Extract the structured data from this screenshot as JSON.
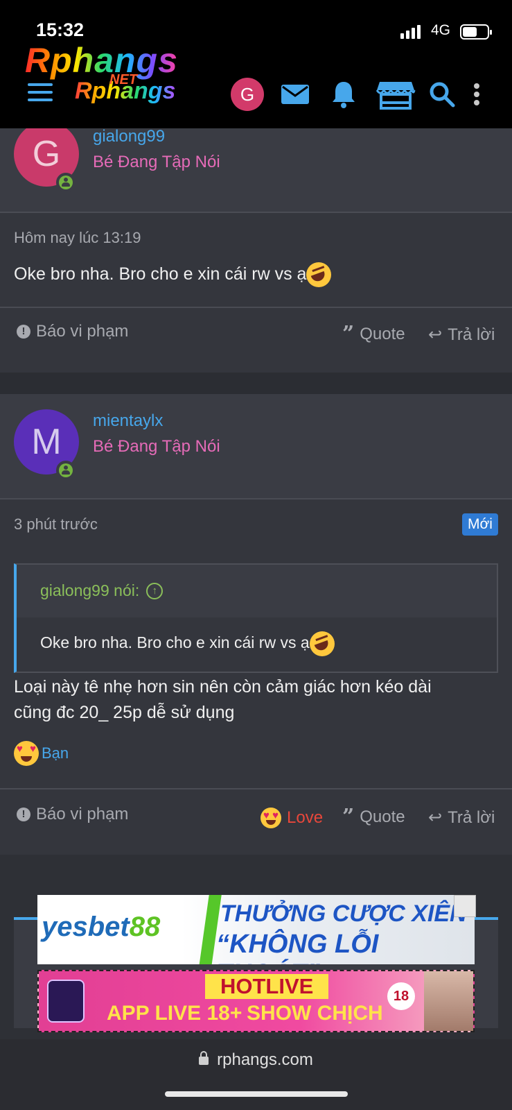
{
  "status_bar": {
    "time": "15:32",
    "network": "4G"
  },
  "header": {
    "logo_text": "Rphangs",
    "logo_small_text": "Rphangs",
    "logo_net_text": "NET",
    "user_initial": "G"
  },
  "posts": [
    {
      "username": "gialong99",
      "user_title": "Bé Đang Tập Nói",
      "avatar_letter": "G",
      "avatar_color": "#c93a6a",
      "time": "Hôm nay lúc 13:19",
      "body": "Oke bro nha. Bro cho e xin cái rw vs ạ",
      "report_label": "Báo vi phạm",
      "quote_label": "Quote",
      "reply_label": "Trả lời"
    },
    {
      "username": "mientaylx",
      "user_title": "Bé Đang Tập Nói",
      "avatar_letter": "M",
      "avatar_color": "#5a2fb8",
      "time": "3 phút trước",
      "new_badge": "Mới",
      "quote": {
        "author_line": "gialong99 nói:",
        "text": "Oke bro nha. Bro cho e xin cái rw vs ạ"
      },
      "body_line1": "Loại này tê nhẹ hơn sin nên còn cảm giác hơn kéo dài",
      "body_line2": "cũng đc 20_ 25p dễ sử dụng",
      "reaction_user": "Bạn",
      "report_label": "Báo vi phạm",
      "love_label": "Love",
      "quote_label": "Quote",
      "reply_label": "Trả lời"
    }
  ],
  "ads": {
    "ad1_brand": "yesbet",
    "ad1_brand_num": "88",
    "ad1_line1": "THƯỞNG CƯỢC XIÊN",
    "ad1_line2": "“KHÔNG LỖI THOÁT”",
    "ad2_title": "HOTLIVE",
    "ad2_left": "APP LIVE 18+",
    "ad2_right": "SHOW CHỊCH",
    "ad2_age": "18"
  },
  "browser": {
    "url": "rphangs.com"
  },
  "colors": {
    "accent": "#47a7eb",
    "user_title": "#e66bb8",
    "love": "#e8473b",
    "quote_author": "#8bbf5a",
    "online": "#74b340"
  }
}
